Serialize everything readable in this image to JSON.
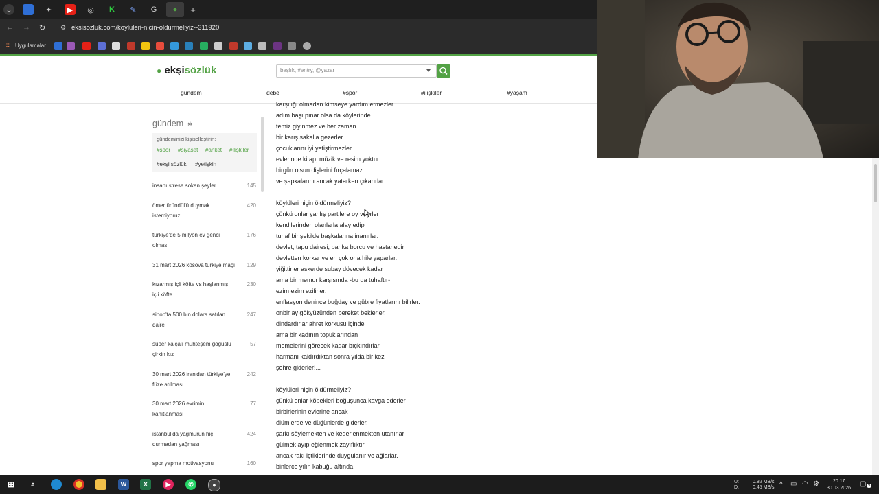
{
  "browser": {
    "url": "eksisozluk.com/koyluleri-nicin-oldurmeliyiz--311920",
    "bookmarks_label": "Uygulamalar",
    "new_tab_label": "+"
  },
  "site": {
    "logo_part1": "ekşi",
    "logo_part2": "sözlük",
    "search_placeholder": "başlık, #entry, @yazar",
    "nav": [
      "gündem",
      "debe",
      "#spor",
      "#ilişkiler",
      "#yaşam",
      "···"
    ]
  },
  "sidebar": {
    "title": "gündem",
    "personalize_label": "gündeminizi kişiselleştirin:",
    "tags_row1": [
      "#spor",
      "#siyaset",
      "#anket",
      "#ilişkiler"
    ],
    "tags_row2": [
      "#ekşi sözlük",
      "#yetişkin"
    ],
    "items": [
      {
        "l1": "insanı strese sokan şeyler",
        "l2": "",
        "count": "145"
      },
      {
        "l1": "ömer üründül'ü duymak",
        "l2": "istemiyoruz",
        "count": "420"
      },
      {
        "l1": "türkiye'de 5 milyon ev genci",
        "l2": "olması",
        "count": "176"
      },
      {
        "l1": "31 mart 2026 kosova türkiye maçı",
        "l2": "",
        "count": "129"
      },
      {
        "l1": "kızarmış içli köfte vs haşlanmış",
        "l2": "içli köfte",
        "count": "230"
      },
      {
        "l1": "sinop'ta 500 bin dolara satılan",
        "l2": "daire",
        "count": "247"
      },
      {
        "l1": "süper kalçalı muhteşem göğüslü",
        "l2": "çirkin kız",
        "count": "57"
      },
      {
        "l1": "30 mart 2026 iran'dan türkiye'ye",
        "l2": "füze atılması",
        "count": "242"
      },
      {
        "l1": "30 mart 2026 evrimin",
        "l2": "kanıtlanması",
        "count": "77"
      },
      {
        "l1": "istanbul'da yağmurun hiç",
        "l2": "durmadan yağması",
        "count": "424"
      },
      {
        "l1": "spor yapma motivasyonu",
        "l2": "",
        "count": "160"
      }
    ]
  },
  "entry_lines": [
    "karşılığı olmadan kimseye yardım etmezler.",
    "adım başı pınar olsa da köylerinde",
    "temiz giyinmez ve her zaman",
    "bir karış sakalla gezerler.",
    "çocuklarını iyi yetiştirmezler",
    "evlerinde kitap, müzik ve resim yoktur.",
    "birgün olsun dişlerini fırçalamaz",
    "ve şapkalarını ancak yatarken çıkarırlar.",
    "",
    "köylüleri niçin öldürmeliyiz?",
    "çünkü onlar yanlış partilere oy verirler",
    "kendilerinden olanlarla alay edip",
    "tuhaf bir şekilde başkalarına inanırlar.",
    "devlet; tapu dairesi, banka borcu ve hastanedir",
    "devletten korkar ve en çok ona hile yaparlar.",
    "yiğittirler askerde subay dövecek kadar",
    "ama bir memur karşısında -bu da tuhaftır-",
    "ezim ezim ezilirler.",
    "enflasyon denince buğday ve gübre fiyatlarını bilirler.",
    "onbir ay gökyüzünden bereket beklerler,",
    "dindardırlar ahret korkusu içinde",
    "ama bir kadının topuklarından",
    "memelerini görecek kadar bıçkındırlar",
    "harmanı kaldırdıktan sonra yılda bir kez",
    "şehre giderler!...",
    "",
    "köylüleri niçin öldürmeliyiz?",
    "çünkü onlar köpekleri boğuşunca kavga ederler",
    "birbirlerinin evlerine ancak",
    "ölümlerde ve düğünlerde giderler.",
    "şarkı söylemekten ve kederlenmekten utanırlar",
    "gülmek ayıp eğlenmek zayıflıktır",
    "ancak rakı içtiklerinde duygulanır ve ağlarlar.",
    "binlerce yılın kabuğu altında"
  ],
  "taskbar": {
    "net_up": "0.82 MB/s",
    "net_down": "0.45 MB/s",
    "net_u": "U:",
    "net_d": "D:",
    "time": "20:17",
    "date": "30.03.2026",
    "notif_count": "5"
  },
  "colors": {
    "brand_green": "#53a245",
    "tag_green": "#53a245"
  }
}
